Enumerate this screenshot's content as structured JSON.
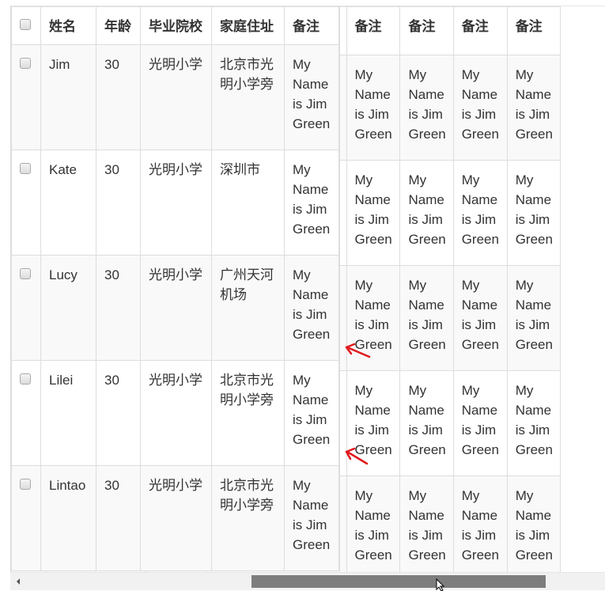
{
  "table": {
    "headers": [
      "姓名",
      "年龄",
      "毕业院校",
      "家庭住址",
      "备注",
      "备注",
      "备注",
      "备注",
      "备注",
      "备注"
    ],
    "rows": [
      {
        "name": "Jim",
        "age": "30",
        "school": "光明小学",
        "address": "北京市光明小学旁",
        "note": "My Name is Jim Green"
      },
      {
        "name": "Kate",
        "age": "30",
        "school": "光明小学",
        "address": "深圳市",
        "note": "My Name is Jim Green"
      },
      {
        "name": "Lucy",
        "age": "30",
        "school": "光明小学",
        "address": "广州天河机场",
        "note": "My Name is Jim Green"
      },
      {
        "name": "Lilei",
        "age": "30",
        "school": "光明小学",
        "address": "北京市光明小学旁",
        "note": "My Name is Jim Green"
      },
      {
        "name": "Lintao",
        "age": "30",
        "school": "光明小学",
        "address": "北京市光明小学旁",
        "note": "My Name is Jim Green"
      }
    ]
  },
  "scrollbar": {
    "position_fraction": 0.41,
    "visible_fraction": 0.5
  },
  "annotation": {
    "arrow_color": "#e0191c"
  }
}
